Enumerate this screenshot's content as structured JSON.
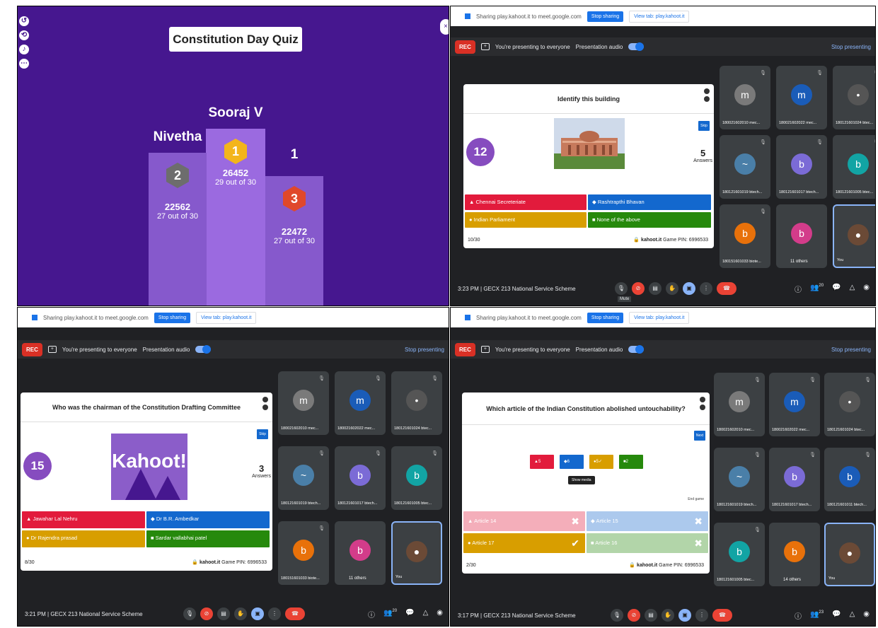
{
  "podium": {
    "quiz_title": "Constitution Day Quiz",
    "first": {
      "name": "Sooraj V",
      "rank": "1",
      "score": "26452",
      "correct": "29 out of 30"
    },
    "second": {
      "name": "Nivetha",
      "rank": "2",
      "score": "22562",
      "correct": "27 out of 30"
    },
    "third": {
      "name": "1",
      "rank": "3",
      "score": "22472",
      "correct": "27 out of 30"
    }
  },
  "meet_common": {
    "sharing_text": "Sharing play.kahoot.it to meet.google.com",
    "stop_sharing": "Stop sharing",
    "view_tab": "View tab: play.kahoot.it",
    "rec": "REC",
    "presenting": "You're presenting to everyone",
    "presentation_audio": "Presentation audio",
    "stop_presenting": "Stop presenting",
    "meeting_name": "GECX 213 National Service Scheme",
    "kahoot_brand": "kahoot.it",
    "game_pin": "Game PIN: 6996533",
    "you": "You"
  },
  "screen2": {
    "question": "Identify this building",
    "timer": "12",
    "answers_count": "5",
    "answers_label": "Answers",
    "skip": "Skip",
    "options": [
      "Chennai Secreteriate",
      "Rashtrapthi Bhavan",
      "Indian Parliament",
      "None of the above"
    ],
    "progress": "10/30",
    "time": "3:23 PM",
    "people_count": "20",
    "mic_tooltip": "Mute",
    "tiles": [
      "180021602010 mec...",
      "180021602022 mec...",
      "180121601024 btec...",
      "180121601019 btech...",
      "180121601017 btech...",
      "180121601005 btec...",
      "180151601033 biote...",
      "11 others",
      "You"
    ]
  },
  "screen3": {
    "question": "Who was the chairman of the Constitution Drafting Committee",
    "timer": "15",
    "answers_count": "3",
    "answers_label": "Answers",
    "skip": "Skip",
    "logo": "Kahoot!",
    "options": [
      "Jawahar Lal Nehru",
      "Dr B.R. Ambedkar",
      "Dr Rajendra prasad",
      "Sardar vallabhai patel"
    ],
    "progress": "8/30",
    "time": "3:21 PM",
    "people_count": "20",
    "tiles": [
      "180021602010 mec...",
      "180021602022 mec...",
      "180121601024 btec...",
      "180121601019 btech...",
      "180121601017 btech...",
      "180121601005 btec...",
      "180151601033 biote...",
      "11 others",
      "You"
    ]
  },
  "screen4": {
    "question": "Which article of the Indian Constitution abolished untouchability?",
    "next": "Next",
    "counts": [
      "5",
      "6",
      "5",
      "2"
    ],
    "show_media": "Show media",
    "end_game": "End game",
    "options": [
      "Article 14",
      "Article 15",
      "Article 17",
      "Article 16"
    ],
    "progress": "2/30",
    "time": "3:17 PM",
    "people_count": "23",
    "tiles": [
      "180021602010 mec...",
      "180021602022 mec...",
      "180121601024 btec...",
      "180121601019 btech...",
      "180121601017 btech...",
      "180121601011 btech...",
      "180121601005 btec...",
      "14 others",
      "You"
    ]
  },
  "colors": {
    "kahoot_purple": "#46178f",
    "meet_bg": "#202124",
    "red": "#e21b3c",
    "blue": "#1368ce",
    "yellow": "#d89e00",
    "green": "#26890c"
  }
}
